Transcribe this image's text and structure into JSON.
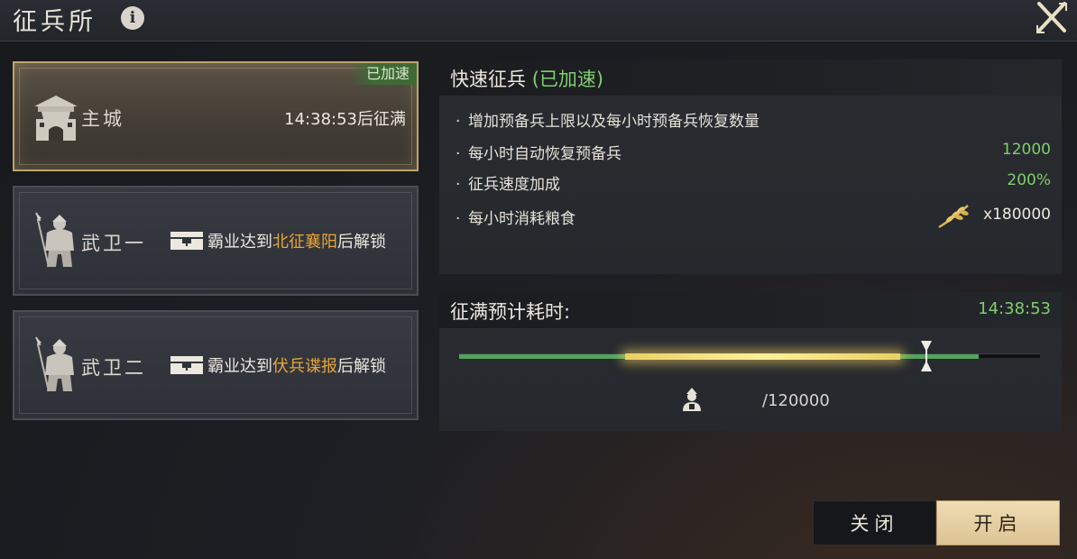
{
  "header": {
    "title": "征兵所",
    "info_glyph": "i"
  },
  "cards": [
    {
      "name": "主城",
      "badge": "已加速",
      "timer": "14:38:53后征满",
      "icon": "castle-icon"
    },
    {
      "name": "武卫一",
      "lock_prefix": "霸业达到",
      "lock_target": "北征襄阳",
      "lock_suffix": "后解锁",
      "icon": "spearman-icon"
    },
    {
      "name": "武卫二",
      "lock_prefix": "霸业达到",
      "lock_target": "伏兵谍报",
      "lock_suffix": "后解锁",
      "icon": "spearman-icon"
    }
  ],
  "speed_panel": {
    "title": "快速征兵",
    "title_status": "(已加速)",
    "rows": [
      {
        "label": "增加预备兵上限以及每小时预备兵恢复数量",
        "value": ""
      },
      {
        "label": "每小时自动恢复预备兵",
        "value": "12000"
      },
      {
        "label": "征兵速度加成",
        "value": "200%"
      },
      {
        "label": "每小时消耗粮食",
        "value": "x180000",
        "icon": "grain-icon"
      }
    ],
    "bullet": "·"
  },
  "estimate_panel": {
    "title": "征满预计耗时:",
    "time": "14:38:53",
    "progress": {
      "green_fraction": 0.895,
      "gold_start_fraction": 0.285,
      "gold_end_fraction": 0.76,
      "marker_fraction": 0.805
    },
    "count": "/120000"
  },
  "buttons": {
    "close": "关闭",
    "open": "开启"
  },
  "colors": {
    "accent_green": "#7fcf6e",
    "accent_gold": "#e8a53a",
    "button_gold": "#e6d0a2"
  }
}
